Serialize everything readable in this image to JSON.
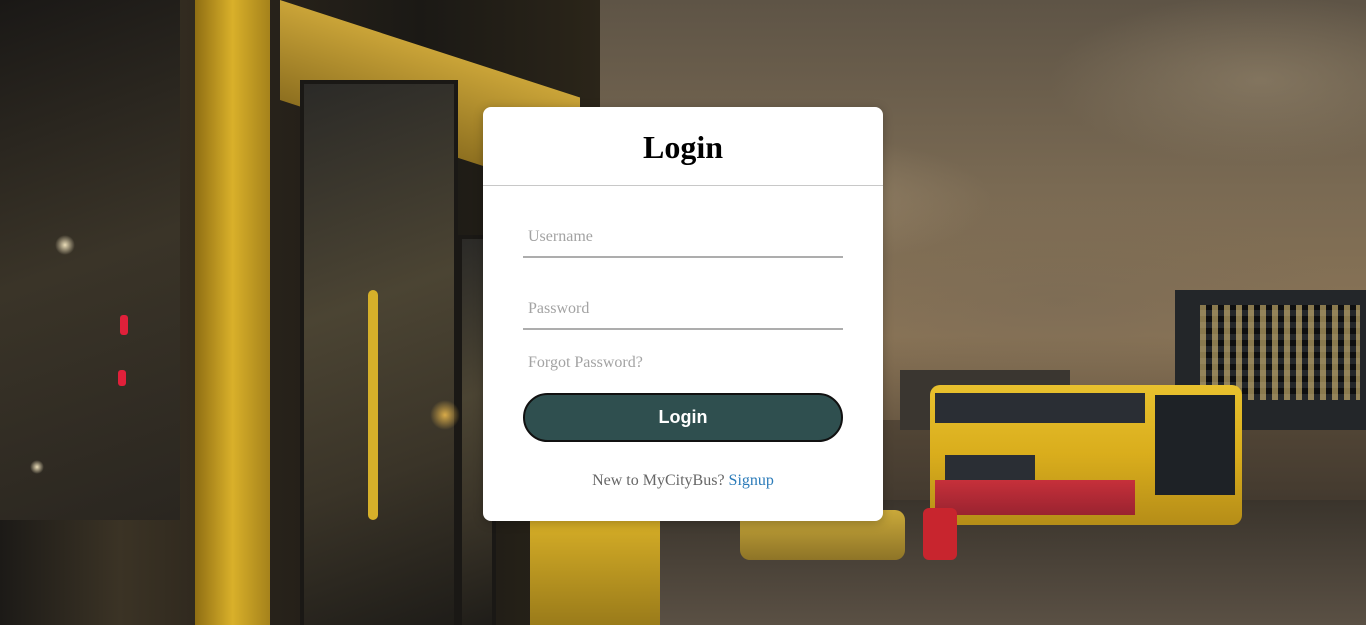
{
  "login": {
    "title": "Login",
    "username_placeholder": "Username",
    "password_placeholder": "Password",
    "forgot_password": "Forgot Password?",
    "submit_label": "Login",
    "signup_prompt": "New to MyCityBus?",
    "signup_link": "Signup"
  },
  "colors": {
    "button_bg": "#2f4f4f",
    "link": "#2b7bb9"
  }
}
